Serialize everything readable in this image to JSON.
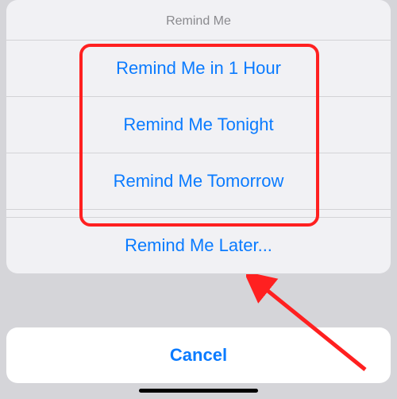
{
  "sheet": {
    "title": "Remind Me",
    "options": [
      "Remind Me in 1 Hour",
      "Remind Me Tonight",
      "Remind Me Tomorrow",
      "Remind Me Later..."
    ]
  },
  "cancel_label": "Cancel"
}
